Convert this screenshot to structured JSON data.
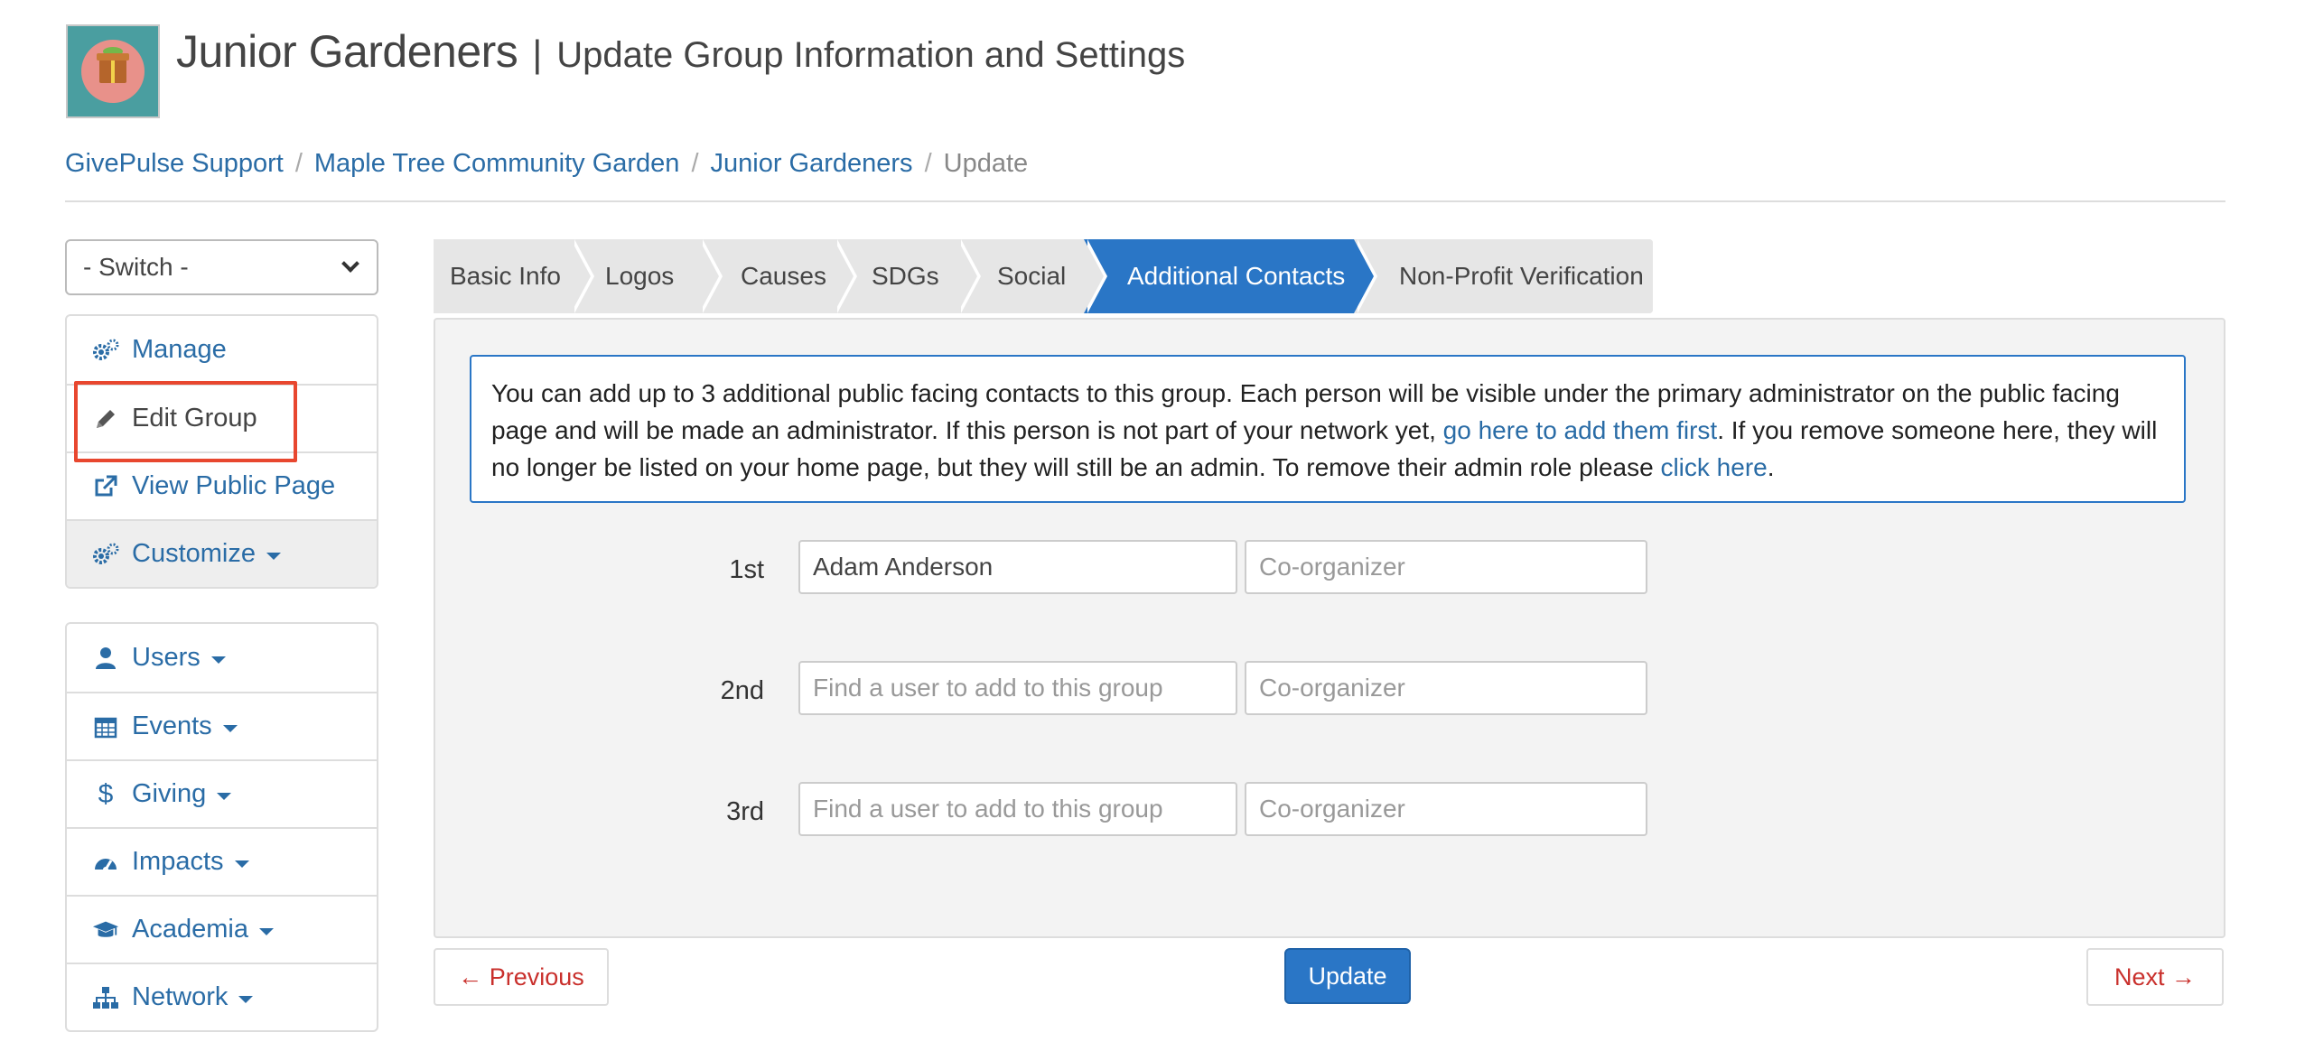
{
  "header": {
    "group_name": "Junior Gardeners",
    "separator": "|",
    "subtitle": "Update Group Information and Settings",
    "logo_icon": "gift-box-logo"
  },
  "breadcrumb": {
    "items": [
      "GivePulse Support",
      "Maple Tree Community Garden",
      "Junior Gardeners",
      "Update"
    ],
    "separator": "/"
  },
  "sidebar": {
    "switch_value": "- Switch -",
    "menu1": [
      {
        "label": "Manage",
        "icon": "cogs-icon"
      },
      {
        "label": "Edit Group",
        "icon": "pencil-icon"
      },
      {
        "label": "View Public Page",
        "icon": "external-link-icon"
      },
      {
        "label": "Customize",
        "icon": "cogs-icon"
      }
    ],
    "menu2": [
      {
        "label": "Users",
        "icon": "user-icon"
      },
      {
        "label": "Events",
        "icon": "calendar-icon"
      },
      {
        "label": "Giving",
        "icon": "dollar-icon"
      },
      {
        "label": "Impacts",
        "icon": "gauge-icon"
      },
      {
        "label": "Academia",
        "icon": "graduation-cap-icon"
      },
      {
        "label": "Network",
        "icon": "sitemap-icon"
      }
    ]
  },
  "tabs": [
    "Basic Info",
    "Logos",
    "Causes",
    "SDGs",
    "Social",
    "Additional Contacts",
    "Non-Profit Verification"
  ],
  "active_tab": "Additional Contacts",
  "info": {
    "text1": "You can add up to 3 additional public facing contacts to this group. Each person will be visible under the primary administrator on the public facing page and will be made an administrator. If this person is not part of your network yet, ",
    "link1": "go here to add them first",
    "text2": ". If you remove someone here, they will no longer be listed on your home page, but they will still be an admin. To remove their admin role please ",
    "link2": "click here",
    "text3": "."
  },
  "contacts": [
    {
      "label": "1st",
      "user_value": "Adam Anderson",
      "user_placeholder": "Find a user to add to this group",
      "role_placeholder": "Co-organizer"
    },
    {
      "label": "2nd",
      "user_value": "",
      "user_placeholder": "Find a user to add to this group",
      "role_placeholder": "Co-organizer"
    },
    {
      "label": "3rd",
      "user_value": "",
      "user_placeholder": "Find a user to add to this group",
      "role_placeholder": "Co-organizer"
    }
  ],
  "buttons": {
    "previous": "← Previous",
    "update": "Update",
    "next": "Next →"
  },
  "colors": {
    "primary": "#2a76c6",
    "link": "#2a6ca6",
    "danger": "#c9302c",
    "highlight": "#e8472f"
  }
}
